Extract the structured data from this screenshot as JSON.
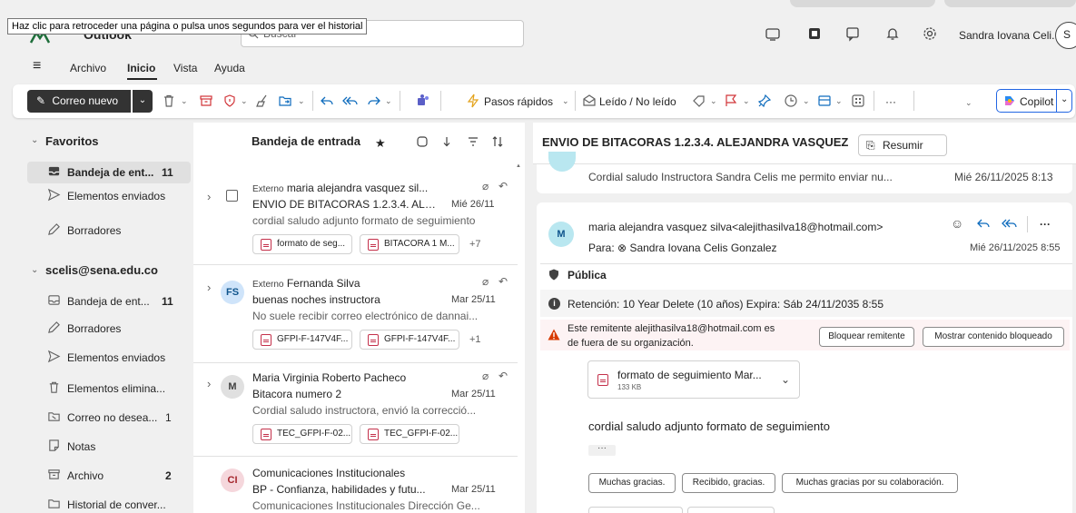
{
  "app": {
    "brand": "Outlook",
    "tooltip": "Haz clic para retroceder una página o pulsa unos segundos para ver el historial",
    "search_placeholder": "Buscar",
    "user_name": "Sandra Iovana Celi...",
    "user_initial": "S"
  },
  "menu": {
    "hamburger": "≡",
    "items": [
      "Archivo",
      "Inicio",
      "Vista",
      "Ayuda"
    ]
  },
  "ribbon": {
    "new_mail": "Correo nuevo",
    "quick_steps": "Pasos rápidos",
    "read_unread": "Leído / No leído",
    "copilot": "Copilot",
    "more": "···"
  },
  "folders": {
    "favorites_label": "Favoritos",
    "favorites": [
      {
        "label": "Bandeja de ent...",
        "count": "11"
      },
      {
        "label": "Elementos enviados",
        "count": ""
      },
      {
        "label": "Borradores",
        "count": ""
      }
    ],
    "account_label": "scelis@sena.edu.co",
    "account": [
      {
        "label": "Bandeja de ent...",
        "count": "11"
      },
      {
        "label": "Borradores",
        "count": ""
      },
      {
        "label": "Elementos enviados",
        "count": ""
      },
      {
        "label": "Elementos elimina...",
        "count": ""
      },
      {
        "label": "Correo no desea...",
        "count": "1"
      },
      {
        "label": "Notas",
        "count": ""
      },
      {
        "label": "Archivo",
        "count": "2"
      },
      {
        "label": "Historial de conver...",
        "count": ""
      }
    ]
  },
  "list": {
    "title": "Bandeja de entrada",
    "messages": [
      {
        "tag": "Externo",
        "sender": "maria alejandra vasquez sil...",
        "subject": "ENVIO DE BITACORAS 1.2.3.4. ALE...",
        "date": "Mié 26/11",
        "preview": "cordial saludo adjunto formato de seguimiento",
        "chips": [
          "formato de seg...",
          "BITACORA 1 M..."
        ],
        "more": "+7"
      },
      {
        "initials": "FS",
        "tag": "Externo",
        "sender": "Fernanda Silva",
        "subject": "buenas noches instructora",
        "date": "Mar 25/11",
        "preview": "No suele recibir correo electrónico de dannai...",
        "chips": [
          "GFPI-F-147V4F...",
          "GFPI-F-147V4F..."
        ],
        "more": "+1"
      },
      {
        "initials": "M",
        "sender": "Maria Virginia Roberto Pacheco",
        "subject": "Bitacora numero 2",
        "date": "Mar 25/11",
        "preview": "Cordial saludo instructora, envió la correcció...",
        "chips": [
          "TEC_GFPI-F-02...",
          "TEC_GFPI-F-02..."
        ],
        "more": ""
      },
      {
        "initials": "CI",
        "sender": "Comunicaciones Institucionales",
        "subject": "BP - Confianza, habilidades y futu...",
        "date": "Mar 25/11",
        "preview": "Comunicaciones Institucionales Dirección Ge..."
      }
    ]
  },
  "reading": {
    "subject": "ENVIO DE BITACORAS 1.2.3.4. ALEJANDRA VASQUEZ",
    "summarize": "Resumir",
    "prev_preview": "Cordial saludo Instructora Sandra Celis me permito enviar nu...",
    "prev_date": "Mié 26/11/2025 8:13",
    "from": "maria alejandra vasquez silva<alejithasilva18@hotmail.com>",
    "to_label": "Para:",
    "to": "Sandra Iovana Celis Gonzalez",
    "date": "Mié 26/11/2025 8:55",
    "sender_initial": "M",
    "sensitivity": "Pública",
    "retention": "Retención: 10 Year Delete (10 años) Expira: Sáb 24/11/2035 8:55",
    "warning_line1": "Este remitente alejithasilva18@hotmail.com es",
    "warning_line2": "de fuera de su organización.",
    "block_sender": "Bloquear remitente",
    "show_blocked": "Mostrar contenido bloqueado",
    "attachment_name": "formato de seguimiento Mar...",
    "attachment_size": "133 KB",
    "body": "cordial saludo adjunto formato de seguimiento",
    "body_more": "···",
    "quick_replies": [
      "Muchas gracias.",
      "Recibido, gracias.",
      "Muchas gracias por su colaboración."
    ]
  },
  "colors": {
    "accent": "#0f6cbd",
    "fs_avatar": "#cfe4fa",
    "m_avatar": "#e0e0e0",
    "ci_avatar": "#f5d7dc",
    "reading_avatar": "#b9e7f0"
  }
}
